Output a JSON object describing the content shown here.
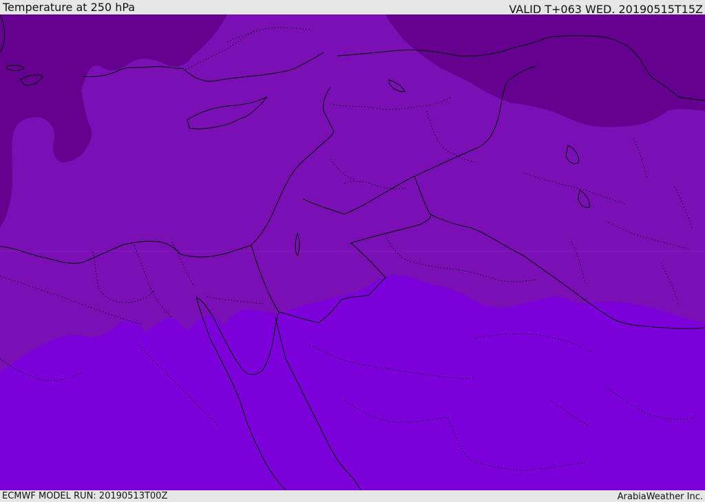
{
  "header": {
    "title": "Temperature at 250 hPa",
    "valid": "VALID T+063 WED. 20190515T15Z"
  },
  "footer": {
    "model_run": "ECMWF MODEL RUN: 20190513T00Z",
    "credit": "ArabiaWeather Inc."
  },
  "map": {
    "field": "temperature",
    "level": "250 hPa",
    "colors": {
      "dark_band": "#63008f",
      "middle_band": "#7a0fb5",
      "warm_band": "#7c00d9",
      "coastline": "#000000",
      "border_line": "#000000"
    }
  }
}
